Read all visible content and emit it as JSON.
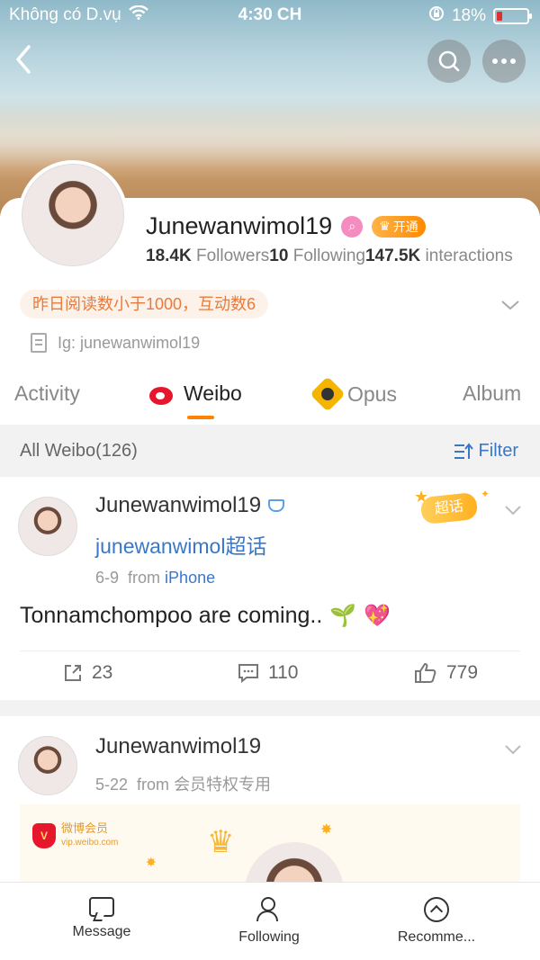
{
  "status_bar": {
    "carrier": "Không có D.vụ",
    "time": "4:30 CH",
    "battery": "18%"
  },
  "header": {
    "back_icon": "chevron-left-icon",
    "search_icon": "search-icon",
    "more_icon": "more-icon"
  },
  "profile": {
    "name": "Junewanwimol19",
    "vip_label": "开通",
    "followers_count": "18.4K",
    "followers_label": "Followers",
    "following_count": "10",
    "following_label": "Following",
    "interactions_count": "147.5K",
    "interactions_label": "interactions",
    "note": "昨日阅读数小于1000，互动数6",
    "bio": "Ig: junewanwimol19"
  },
  "tabs": [
    {
      "label": "Activity"
    },
    {
      "label": "Weibo"
    },
    {
      "label": "Opus"
    },
    {
      "label": "Album"
    }
  ],
  "filter_bar": {
    "label": "All Weibo(126)",
    "filter_label": "Filter"
  },
  "posts": [
    {
      "author": "Junewanwimol19",
      "topic": "junewanwimol超话",
      "date": "6-9",
      "from": "from",
      "source": "iPhone",
      "badge": "超话",
      "text": "Tonnamchompoo are coming..",
      "reposts": "23",
      "comments": "110",
      "likes": "779"
    },
    {
      "author": "Junewanwimol19",
      "date": "5-22",
      "from": "from",
      "source": "会员特权专用",
      "vip_logo_text": "微博会员",
      "vip_logo_url": "vip.weibo.com"
    }
  ],
  "bottom_nav": [
    {
      "label": "Message"
    },
    {
      "label": "Following"
    },
    {
      "label": "Recomme..."
    }
  ],
  "colors": {
    "accent": "#ff8200",
    "link": "#3a78c7",
    "note_text": "#ea7a3a",
    "weibo_red": "#e6162d"
  }
}
